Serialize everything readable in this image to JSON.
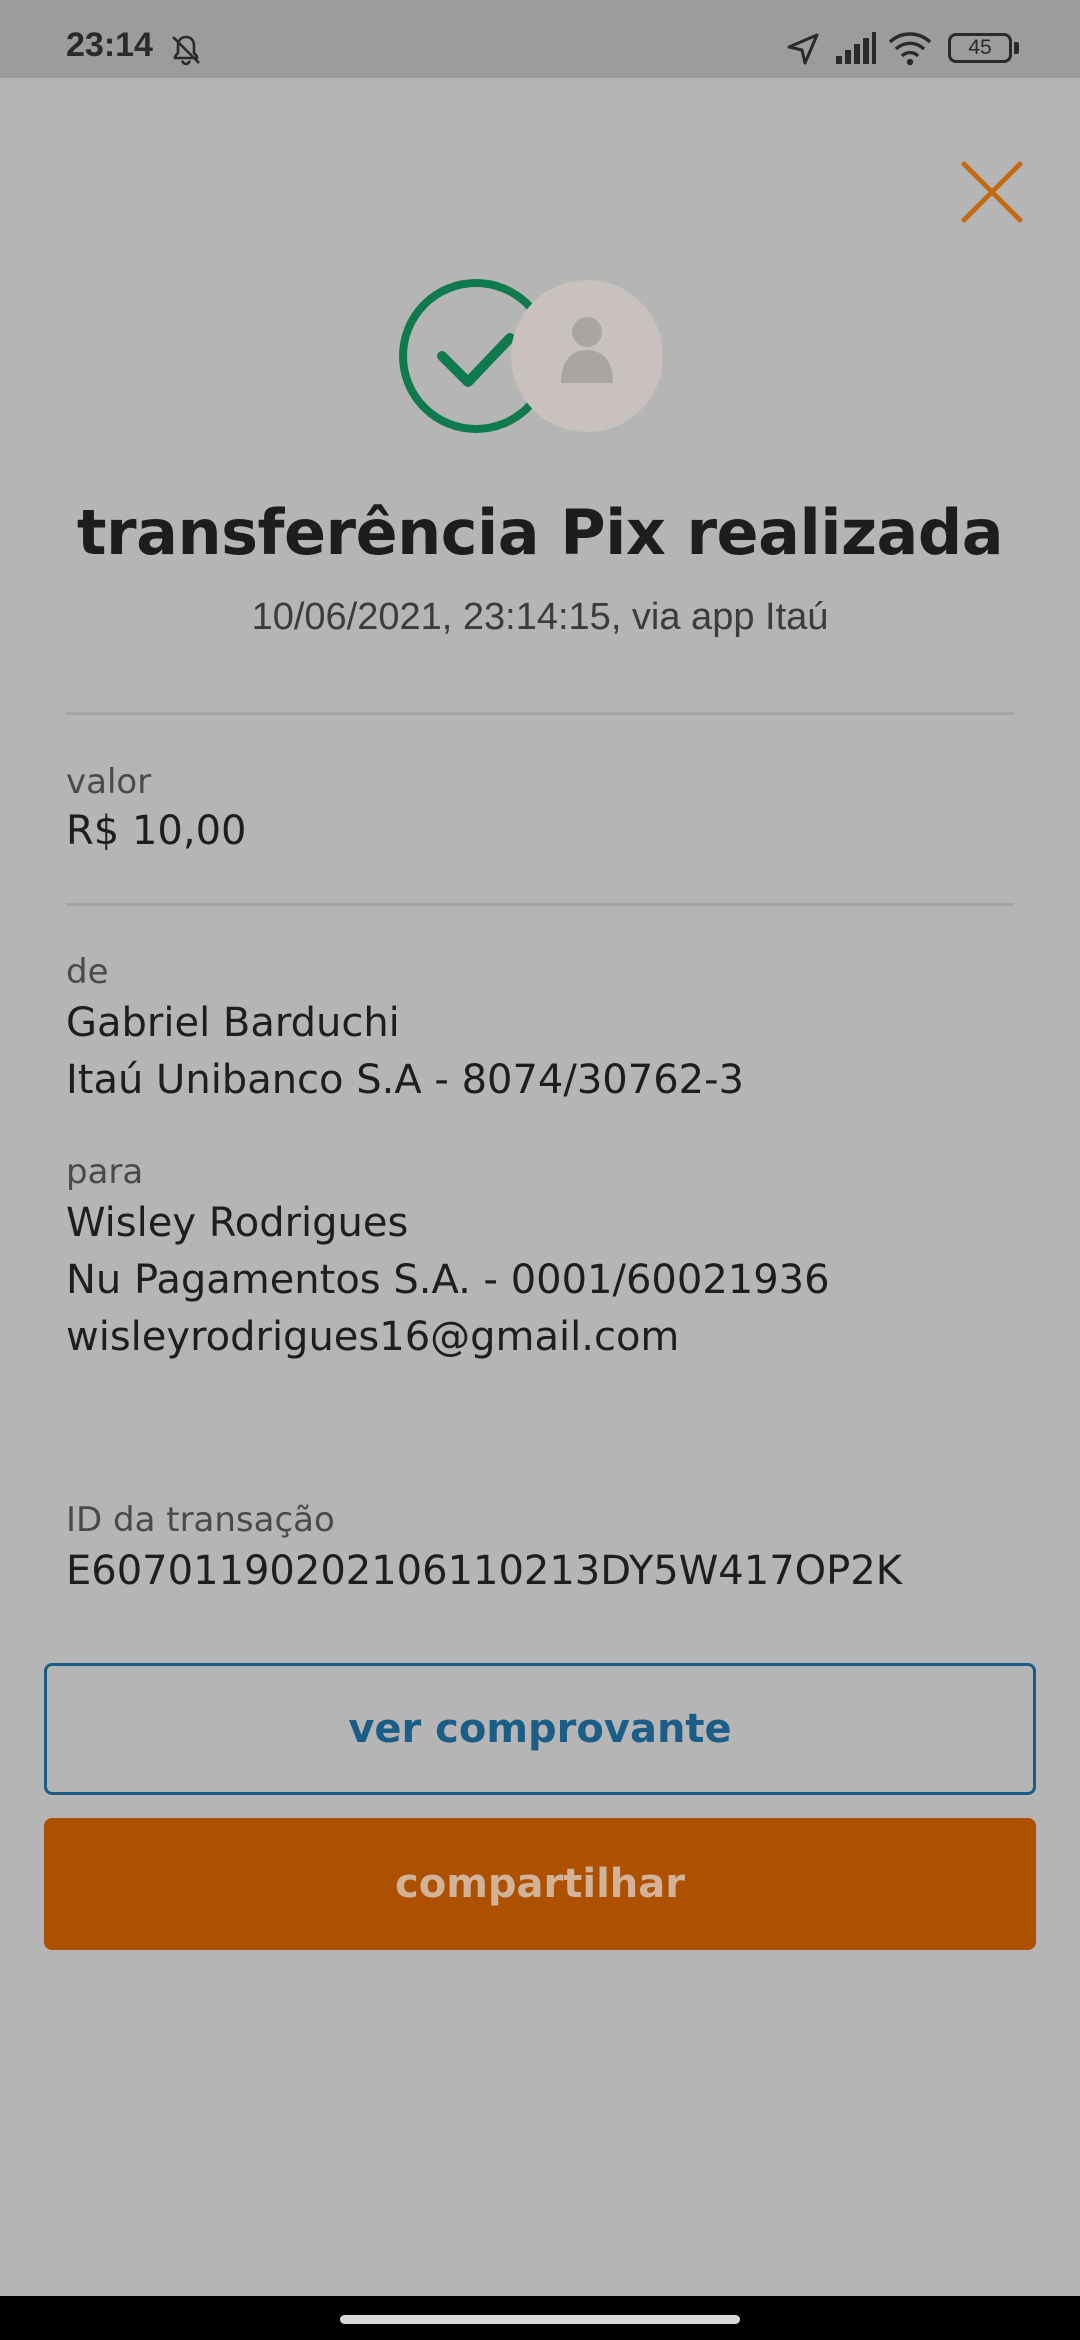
{
  "status_bar": {
    "time": "23:14",
    "battery": "45",
    "icons": [
      "bell-off-icon",
      "location-arrow-icon",
      "signal-icon",
      "wifi-icon",
      "battery-icon"
    ]
  },
  "header": {
    "close_icon": "close-icon",
    "accent_color": "#c46a17"
  },
  "hero": {
    "success_icon": "check-circle-icon",
    "avatar_icon": "person-avatar-icon",
    "success_color": "#0f7a4e"
  },
  "title": "transferência Pix realizada",
  "subtitle": "10/06/2021,  23:14:15, via app Itaú",
  "valor": {
    "label": "valor",
    "amount": "R$ 10,00"
  },
  "de": {
    "label": "de",
    "name": "Gabriel Barduchi",
    "bank": "Itaú Unibanco S.A - 8074/30762-3"
  },
  "para": {
    "label": "para",
    "name": "Wisley Rodrigues",
    "bank": "Nu Pagamentos S.A. - 0001/60021936",
    "email": "wisleyrodrigues16@gmail.com"
  },
  "transaction": {
    "label": "ID da transação",
    "id": "E60701190202106110213DY5W417OP2K"
  },
  "buttons": {
    "view_receipt": "ver comprovante",
    "share": "compartilhar"
  }
}
